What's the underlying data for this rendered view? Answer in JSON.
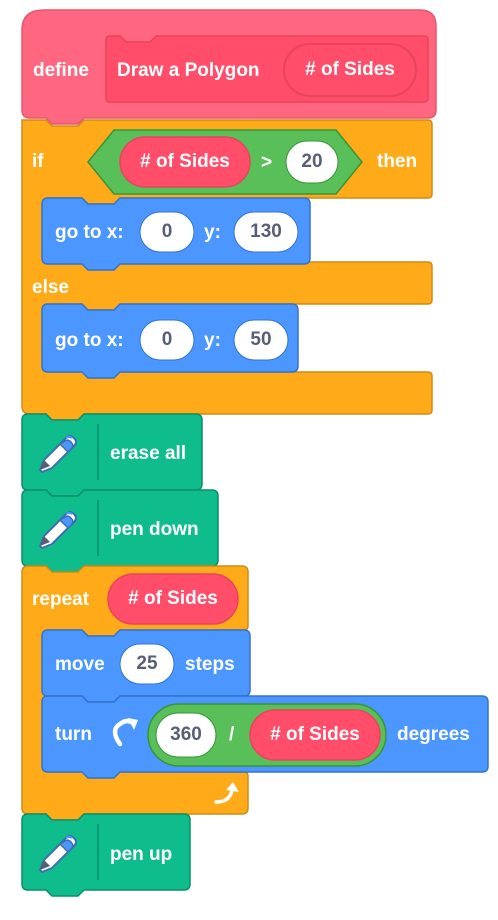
{
  "colors": {
    "define": "#ff6680",
    "define_dark": "#ff4d6a",
    "custom": "#ff4d6a",
    "custom_dark": "#e8445e",
    "control": "#ffab19",
    "control_dark": "#cf8b17",
    "motion": "#4c97ff",
    "motion_dark": "#3373cc",
    "pen": "#0fbd8c",
    "pen_dark": "#0b8e69",
    "operator": "#59c059",
    "operator_dark": "#389438",
    "input_bg": "#ffffff",
    "input_text": "#575e75"
  },
  "script": {
    "define_block": {
      "keyword": "define",
      "proc_name": "Draw a Polygon",
      "param": "# of Sides"
    },
    "if_block": {
      "if_label": "if",
      "condition": {
        "left": "# of Sides",
        "operator": ">",
        "right": "20"
      },
      "then_label": "then",
      "else_label": "else"
    },
    "goto_high": {
      "label": "go to x:",
      "x": "0",
      "y_label": "y:",
      "y": "130"
    },
    "goto_low": {
      "label": "go to x:",
      "x": "0",
      "y_label": "y:",
      "y": "50"
    },
    "erase_block": {
      "label": "erase all",
      "icon": "pen-icon"
    },
    "pen_down_block": {
      "label": "pen down",
      "icon": "pen-icon"
    },
    "repeat_block": {
      "label": "repeat",
      "times": "# of Sides",
      "loop_icon": "loop-arrow-icon"
    },
    "move_block": {
      "label": "move",
      "steps": "25",
      "suffix": "steps"
    },
    "turn_block": {
      "label": "turn",
      "icon": "rotate-clockwise-icon",
      "dividend": "360",
      "operator": "/",
      "divisor": "# of Sides",
      "suffix": "degrees"
    },
    "pen_up_block": {
      "label": "pen up",
      "icon": "pen-icon"
    }
  }
}
